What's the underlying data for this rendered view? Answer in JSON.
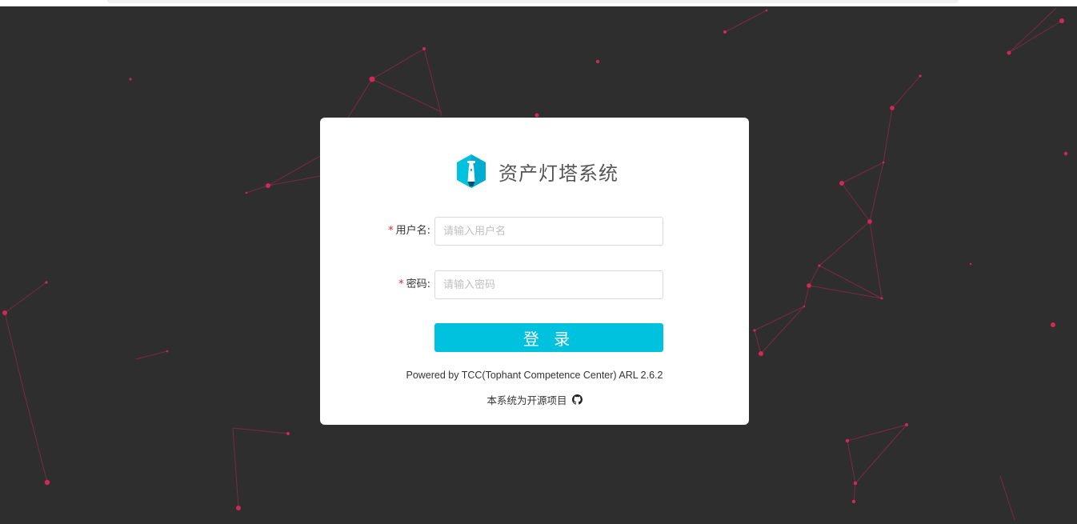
{
  "app": {
    "title": "资产灯塔系统",
    "logo_icon": "lighthouse-logo-icon",
    "accent_color": "#00c1de",
    "background_color": "#2f2e2f",
    "network_dot_color": "#d0285a"
  },
  "login_form": {
    "username": {
      "label": "用户名:",
      "required": "*",
      "placeholder": "请输入用户名",
      "value": ""
    },
    "password": {
      "label": "密码:",
      "required": "*",
      "placeholder": "请输入密码",
      "value": ""
    },
    "submit_label": "登 录"
  },
  "footer": {
    "powered_by": "Powered by TCC(Tophant Competence Center) ARL 2.6.2",
    "open_source_text": "本系统为开源项目",
    "open_source_icon": "github-icon"
  }
}
